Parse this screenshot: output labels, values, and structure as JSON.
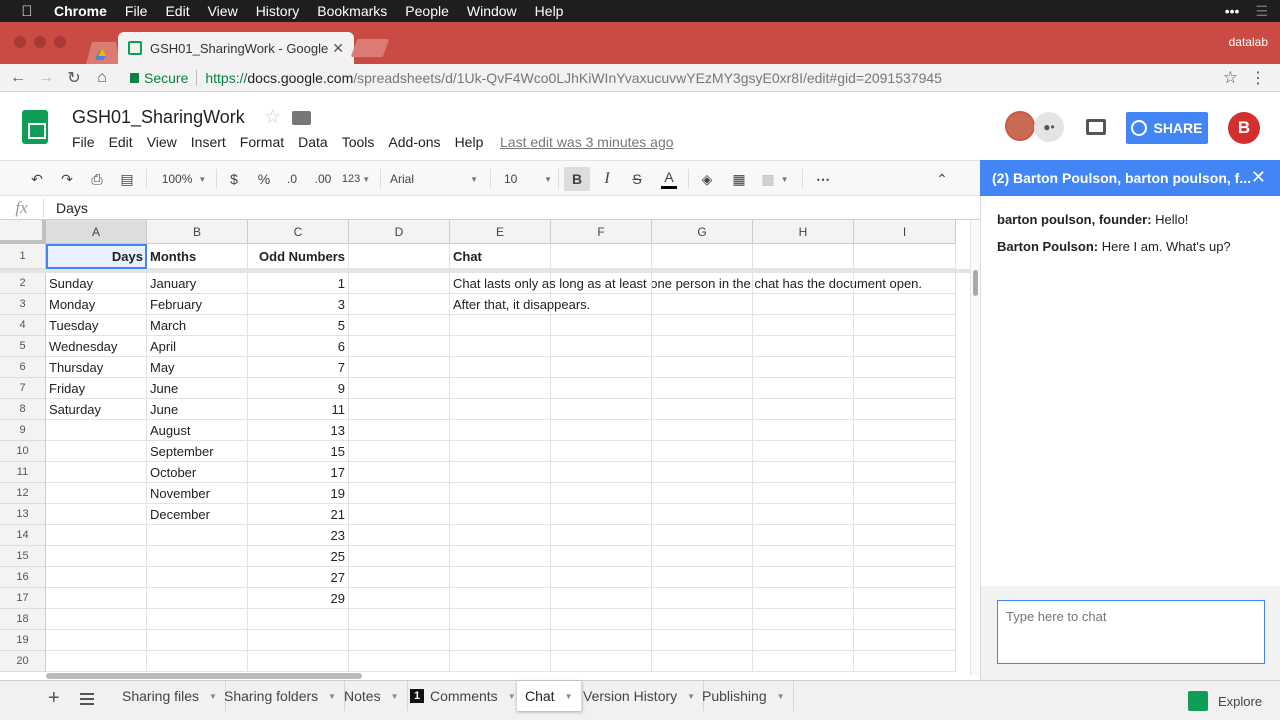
{
  "macos_menu": {
    "app": "Chrome",
    "items": [
      "File",
      "Edit",
      "View",
      "History",
      "Bookmarks",
      "People",
      "Window",
      "Help"
    ],
    "right_icons": [
      "ellipsis-icon",
      "list-icon"
    ]
  },
  "browser": {
    "tab_title": "GSH01_SharingWork - Google",
    "profile": "datalab",
    "secure_label": "Secure",
    "url_scheme": "https://",
    "url_host": "docs.google.com",
    "url_path": "/spreadsheets/d/1Uk-QvF4Wco0LJhKiWInYvaxucuvwYEzMY3gsyE0xr8I/edit#gid=2091537945"
  },
  "doc": {
    "title": "GSH01_SharingWork",
    "menu": [
      "File",
      "Edit",
      "View",
      "Insert",
      "Format",
      "Data",
      "Tools",
      "Add-ons",
      "Help"
    ],
    "last_edit": "Last edit was 3 minutes ago",
    "share_label": "SHARE",
    "user_initial": "B"
  },
  "toolbar": {
    "zoom": "100%",
    "currency": "$",
    "percent": "%",
    "dec_decrease": ".0",
    "dec_increase": ".00",
    "more_formats": "123",
    "font": "Arial",
    "font_size": "10",
    "bold": "B",
    "italic": "I",
    "strike": "S",
    "text_color": "A",
    "more": "⋯"
  },
  "formula_bar": {
    "fx": "fx",
    "value": "Days"
  },
  "grid": {
    "columns": [
      "A",
      "B",
      "C",
      "D",
      "E",
      "F",
      "G",
      "H",
      "I"
    ],
    "rows": [
      [
        "Days",
        "Months",
        "Odd Numbers",
        "",
        "Chat"
      ],
      [
        "Sunday",
        "January",
        "1",
        "",
        "Chat lasts only as long as at least one person in the chat has the document open."
      ],
      [
        "Monday",
        "February",
        "3",
        "",
        "After that, it disappears."
      ],
      [
        "Tuesday",
        "March",
        "5",
        "",
        ""
      ],
      [
        "Wednesday",
        "April",
        "6",
        "",
        ""
      ],
      [
        "Thursday",
        "May",
        "7",
        "",
        ""
      ],
      [
        "Friday",
        "June",
        "9",
        "",
        ""
      ],
      [
        "Saturday",
        "June",
        "11",
        "",
        ""
      ],
      [
        "",
        "August",
        "13",
        "",
        ""
      ],
      [
        "",
        "September",
        "15",
        "",
        ""
      ],
      [
        "",
        "October",
        "17",
        "",
        ""
      ],
      [
        "",
        "November",
        "19",
        "",
        ""
      ],
      [
        "",
        "December",
        "21",
        "",
        ""
      ],
      [
        "",
        "",
        "23",
        "",
        ""
      ],
      [
        "",
        "",
        "25",
        "",
        ""
      ],
      [
        "",
        "",
        "27",
        "",
        ""
      ],
      [
        "",
        "",
        "29",
        "",
        ""
      ],
      [
        "",
        "",
        "",
        "",
        ""
      ],
      [
        "",
        "",
        "",
        "",
        ""
      ],
      [
        "",
        "",
        "",
        "",
        ""
      ]
    ]
  },
  "chat": {
    "header": "(2) Barton Poulson, barton poulson, f...",
    "messages": [
      {
        "author": "barton poulson, founder:",
        "text": "Hello!"
      },
      {
        "author": "Barton Poulson:",
        "text": "Here I am. What's up?"
      }
    ],
    "input_placeholder": "Type here to chat"
  },
  "sheet_tabs": [
    {
      "label": "Sharing files",
      "active": false,
      "badge": ""
    },
    {
      "label": "Sharing folders",
      "active": false,
      "badge": ""
    },
    {
      "label": "Notes",
      "active": false,
      "badge": ""
    },
    {
      "label": "Comments",
      "active": false,
      "badge": "1"
    },
    {
      "label": "Chat",
      "active": true,
      "badge": ""
    },
    {
      "label": "Version History",
      "active": false,
      "badge": ""
    },
    {
      "label": "Publishing",
      "active": false,
      "badge": ""
    }
  ],
  "explore_label": "Explore",
  "colors": {
    "tab_strip": "#c94b44",
    "accent_blue": "#4285f4",
    "sheets_green": "#0f9d58"
  }
}
